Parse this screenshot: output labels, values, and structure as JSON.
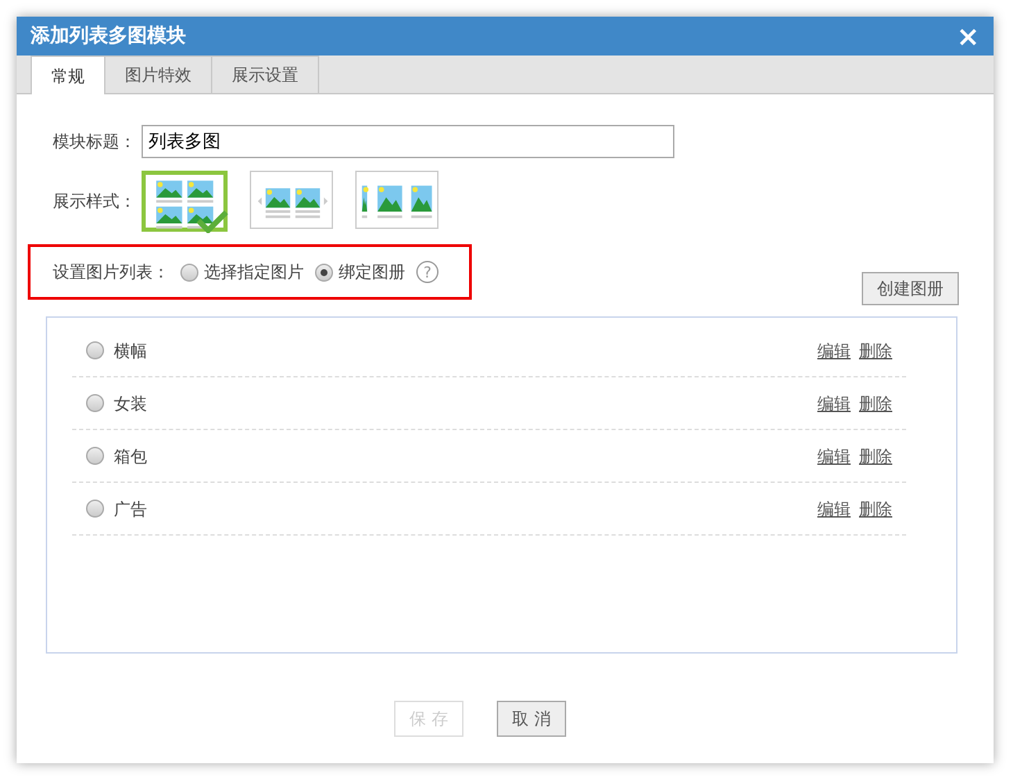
{
  "window": {
    "title": "添加列表多图模块",
    "close": "×"
  },
  "tabs": [
    {
      "label": "常规",
      "selected": true
    },
    {
      "label": "图片特效",
      "selected": false
    },
    {
      "label": "展示设置",
      "selected": false
    }
  ],
  "module_title": {
    "label": "模块标题：",
    "value": "列表多图"
  },
  "display_style": {
    "label": "展示样式：",
    "options": [
      {
        "kind": "grid",
        "selected": true
      },
      {
        "kind": "carousel",
        "selected": false
      },
      {
        "kind": "strip",
        "selected": false
      }
    ]
  },
  "image_list": {
    "label": "设置图片列表：",
    "options": [
      {
        "label": "选择指定图片",
        "selected": false
      },
      {
        "label": "绑定图册",
        "selected": true
      }
    ],
    "help": "?"
  },
  "create_album_button": "创建图册",
  "albums": [
    {
      "name": "横幅",
      "selected": false,
      "edit": "编辑",
      "delete": "删除"
    },
    {
      "name": "女装",
      "selected": false,
      "edit": "编辑",
      "delete": "删除"
    },
    {
      "name": "箱包",
      "selected": false,
      "edit": "编辑",
      "delete": "删除"
    },
    {
      "name": "广告",
      "selected": false,
      "edit": "编辑",
      "delete": "删除"
    }
  ],
  "buttons": [
    {
      "label": "保 存",
      "disabled": true
    },
    {
      "label": "取 消",
      "disabled": false
    }
  ]
}
